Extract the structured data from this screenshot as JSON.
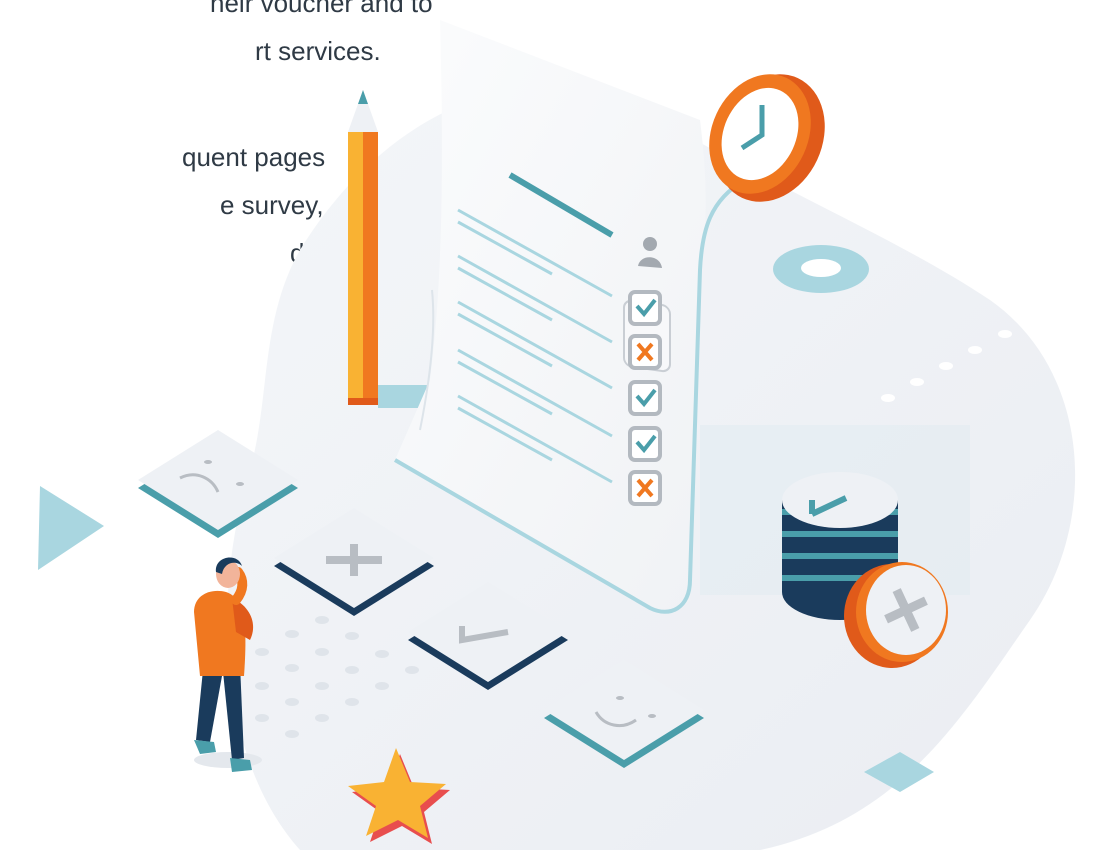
{
  "intro_text": {
    "lines": [
      "heir voucher and to",
      "rt services.",
      "quent pages",
      "e survey,",
      "d"
    ]
  },
  "colors": {
    "text": "#2f3a45",
    "teal": "#4a9eaa",
    "light_teal": "#a9d6e0",
    "navy": "#1a3b5c",
    "orange": "#f07820",
    "dark_orange": "#e05a1a",
    "yellow": "#f9b233",
    "red": "#e84e4e",
    "grey_key": "#e9ebee",
    "blob": "#eef1f5"
  },
  "icons": {
    "clock": "clock-icon",
    "pencil": "pencil-icon",
    "person": "person-icon",
    "star": "star-icon",
    "coin_stack": "coin-stack-icon"
  },
  "survey_checklist": [
    "check",
    "cross",
    "check",
    "check",
    "cross"
  ],
  "feedback_keys": [
    "sad-face",
    "plus",
    "check",
    "happy-face"
  ]
}
